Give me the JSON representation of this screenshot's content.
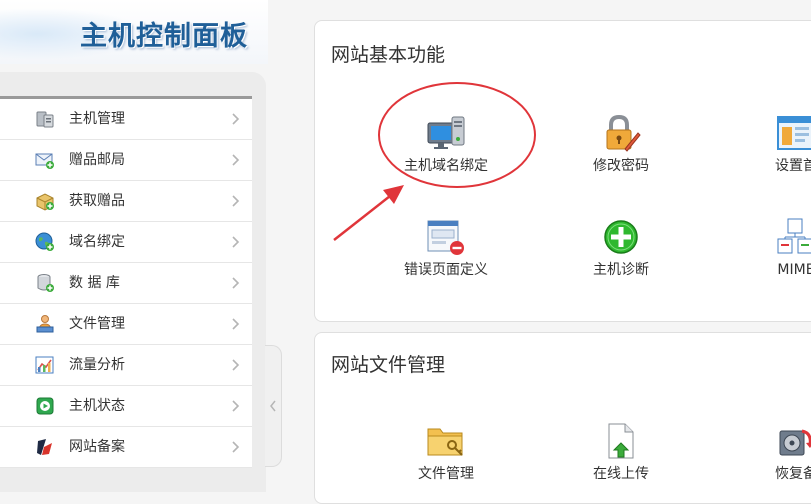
{
  "header": {
    "logo_text": "主机控制面板"
  },
  "sidebar": {
    "items": [
      {
        "label": "主机管理",
        "icon": "host-server-icon"
      },
      {
        "label": "赠品邮局",
        "icon": "mail-add-icon"
      },
      {
        "label": "获取赠品",
        "icon": "gift-box-icon"
      },
      {
        "label": "域名绑定",
        "icon": "globe-icon"
      },
      {
        "label": "数 据 库",
        "icon": "database-icon"
      },
      {
        "label": "文件管理",
        "icon": "file-manager-icon"
      },
      {
        "label": "流量分析",
        "icon": "traffic-chart-icon"
      },
      {
        "label": "主机状态",
        "icon": "status-play-icon"
      },
      {
        "label": "网站备案",
        "icon": "record-icon"
      }
    ]
  },
  "panels": {
    "basic": {
      "title": "网站基本功能",
      "items": [
        {
          "label": "主机域名绑定",
          "icon": "host-domain-binding-icon"
        },
        {
          "label": "修改密码",
          "icon": "lock-pencil-icon"
        },
        {
          "label": "设置首",
          "icon": "homepage-setting-icon"
        },
        {
          "label": "错误页面定义",
          "icon": "error-page-icon"
        },
        {
          "label": "主机诊断",
          "icon": "diagnosis-plus-icon"
        },
        {
          "label": "MIME",
          "icon": "mime-icon"
        }
      ]
    },
    "files": {
      "title": "网站文件管理",
      "items": [
        {
          "label": "文件管理",
          "icon": "folder-key-icon"
        },
        {
          "label": "在线上传",
          "icon": "upload-icon"
        },
        {
          "label": "恢复备",
          "icon": "restore-backup-icon"
        }
      ]
    }
  },
  "colors": {
    "annotation": "#e0353a",
    "logo": "#1f5f98",
    "sidebar_border": "#9a9a9a"
  }
}
